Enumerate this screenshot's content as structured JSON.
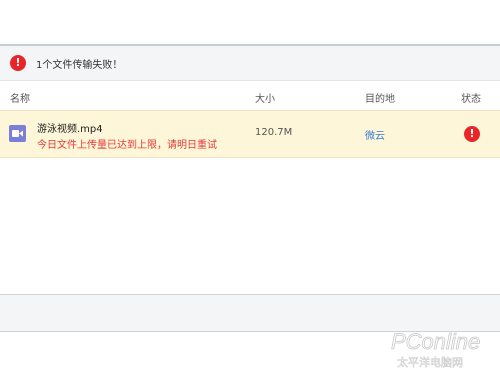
{
  "alert": {
    "icon": "error-icon",
    "message": "1个文件传输失败！",
    "color": "#e8262a"
  },
  "columns": {
    "name": "名称",
    "size": "大小",
    "destination": "目的地",
    "status": "状态"
  },
  "files": [
    {
      "icon": "video-file-icon",
      "name": "游泳视频.mp4",
      "error": "今日文件上传量已达到上限，请明日重试",
      "size": "120.7M",
      "destination": "微云",
      "status_icon": "error-icon"
    }
  ],
  "watermark": {
    "brand": "PConline",
    "tagline": "太平洋电脑网"
  },
  "colors": {
    "error": "#e53935",
    "link": "#3a7bd5",
    "row_highlight": "#fdf6d8",
    "file_icon": "#7b7fd6"
  }
}
